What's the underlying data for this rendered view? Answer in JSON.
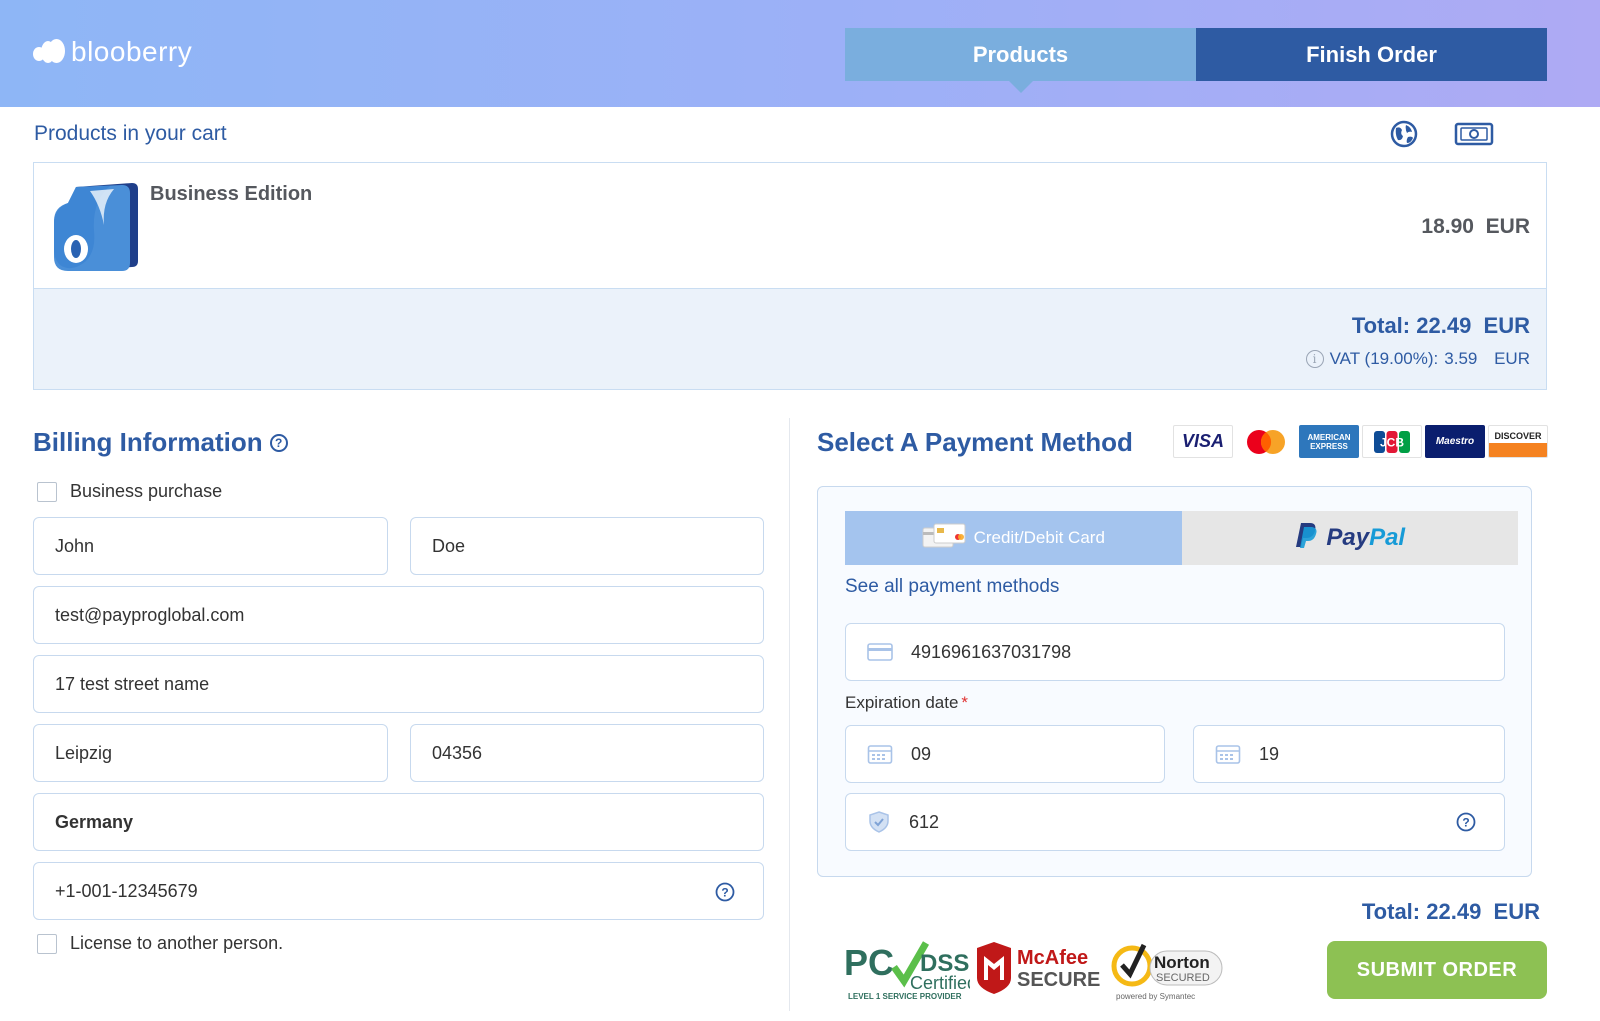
{
  "brand": {
    "name": "blooberry"
  },
  "nav": {
    "products": "Products",
    "finish_order": "Finish Order"
  },
  "cart": {
    "title": "Products in your cart",
    "tools": [
      "globe-icon",
      "currency-icon"
    ],
    "items": [
      {
        "name": "Business Edition",
        "price": "18.90",
        "currency": "EUR"
      }
    ],
    "total_label": "Total:",
    "total_value": "22.49",
    "total_currency": "EUR",
    "vat_label": "VAT (19.00%):",
    "vat_value": "3.59",
    "vat_currency": "EUR"
  },
  "billing": {
    "title": "Billing Information",
    "business_purchase": "Business purchase",
    "first_name": "John",
    "last_name": "Doe",
    "email": "test@payproglobal.com",
    "street": "17 test street name",
    "city": "Leipzig",
    "zip": "04356",
    "country": "Germany",
    "phone": "+1-001-12345679",
    "license_other": "License to another person."
  },
  "payment": {
    "title": "Select A Payment Method",
    "card_logos": [
      "VISA",
      "MasterCard",
      "AMERICAN EXPRESS",
      "JCB",
      "Maestro",
      "DISCOVER"
    ],
    "tab_card": "Credit/Debit Card",
    "tab_paypal_a": "Pay",
    "tab_paypal_b": "Pal",
    "see_all": "See all payment methods",
    "card_number": "4916961637031798",
    "expiration_label": "Expiration date",
    "exp_month": "09",
    "exp_year": "19",
    "cvv": "612"
  },
  "order": {
    "total_label": "Total:",
    "total_value": "22.49",
    "total_currency": "EUR",
    "submit": "SUBMIT ORDER"
  },
  "seals": {
    "pci_main": "PCI DSS",
    "pci_sub": "Certified",
    "pci_foot": "LEVEL 1 SERVICE PROVIDER",
    "mcafee_top": "McAfee",
    "mcafee_bottom": "SECURE",
    "norton_top": "Norton",
    "norton_bottom": "SECURED",
    "norton_foot": "powered by Symantec"
  },
  "colors": {
    "brand_blue": "#2e5ba3",
    "header_light": "#7aaede",
    "submit_green": "#8dc153"
  }
}
